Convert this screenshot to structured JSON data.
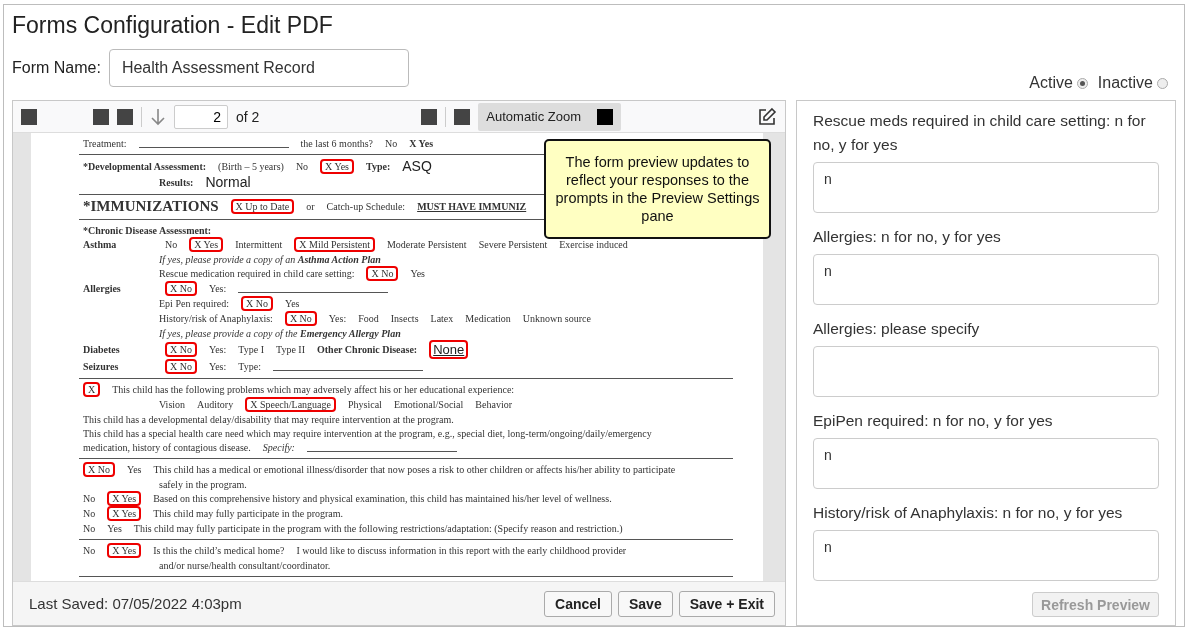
{
  "window": {
    "title": "Forms Configuration - Edit PDF"
  },
  "form_name": {
    "label": "Form Name:",
    "value": "Health Assessment Record"
  },
  "status": [
    {
      "label": "Active",
      "selected": true
    },
    {
      "label": "Inactive",
      "selected": false
    }
  ],
  "viewer_toolbar": {
    "page": "2",
    "page_count": "of 2",
    "zoom": "Automatic Zoom"
  },
  "pdf_sections": [
    [
      {
        "indent": false,
        "segments": [
          {
            "kind": "text",
            "text": "Treatment:"
          },
          {
            "kind": "blank"
          },
          {
            "kind": "text",
            "text": "the last 6 months?"
          },
          {
            "kind": "text",
            "text": "No"
          },
          {
            "kind": "bold",
            "text": "X Yes"
          }
        ]
      }
    ],
    [
      {
        "indent": false,
        "segments": [
          {
            "kind": "bold",
            "text": "*Developmental Assessment:"
          },
          {
            "kind": "text",
            "text": "(Birth – 5 years)"
          },
          {
            "kind": "text",
            "text": "No"
          },
          {
            "kind": "mark",
            "text": "X Yes"
          },
          {
            "kind": "bold",
            "text": "Type:"
          },
          {
            "kind": "value",
            "text": "ASQ"
          }
        ]
      },
      {
        "indent": true,
        "segments": [
          {
            "kind": "bold",
            "text": "Results:"
          },
          {
            "kind": "value",
            "text": "Normal"
          }
        ]
      }
    ],
    [
      {
        "indent": false,
        "segments": [
          {
            "kind": "heading",
            "text": "*IMMUNIZATIONS"
          },
          {
            "kind": "mark",
            "text": "X Up to Date"
          },
          {
            "kind": "text",
            "text": "or"
          },
          {
            "kind": "text",
            "text": "Catch-up Schedule:"
          },
          {
            "kind": "link",
            "text": "MUST HAVE IMMUNIZ"
          }
        ]
      }
    ],
    [
      {
        "indent": false,
        "segments": [
          {
            "kind": "bold",
            "text": "*Chronic Disease Assessment:"
          }
        ]
      },
      {
        "indent": false,
        "segments": [
          {
            "kind": "rowlabel",
            "text": "Asthma"
          },
          {
            "kind": "text",
            "text": "No"
          },
          {
            "kind": "mark",
            "text": "X Yes"
          },
          {
            "kind": "text",
            "text": "Intermittent"
          },
          {
            "kind": "mark",
            "text": "X Mild Persistent"
          },
          {
            "kind": "text",
            "text": "Moderate Persistent"
          },
          {
            "kind": "text",
            "text": "Severe Persistent"
          },
          {
            "kind": "text",
            "text": "Exercise induced"
          }
        ]
      },
      {
        "indent": true,
        "segments": [
          {
            "kind": "italic",
            "text": "If yes, please provide a copy of an **Asthma Action Plan**"
          }
        ]
      },
      {
        "indent": true,
        "segments": [
          {
            "kind": "text",
            "text": "Rescue medication required in child care setting:"
          },
          {
            "kind": "mark",
            "text": "X No"
          },
          {
            "kind": "text",
            "text": "Yes"
          }
        ]
      },
      {
        "indent": false,
        "segments": [
          {
            "kind": "rowlabel",
            "text": "Allergies"
          },
          {
            "kind": "mark",
            "text": "X No"
          },
          {
            "kind": "text",
            "text": "Yes:"
          },
          {
            "kind": "blank"
          }
        ]
      },
      {
        "indent": true,
        "segments": [
          {
            "kind": "text",
            "text": "Epi Pen required:"
          },
          {
            "kind": "mark",
            "text": "X No"
          },
          {
            "kind": "text",
            "text": "Yes"
          }
        ]
      },
      {
        "indent": true,
        "segments": [
          {
            "kind": "text",
            "text": "History/risk of Anaphylaxis:"
          },
          {
            "kind": "mark",
            "text": "X No"
          },
          {
            "kind": "text",
            "text": "Yes:"
          },
          {
            "kind": "text",
            "text": "Food"
          },
          {
            "kind": "text",
            "text": "Insects"
          },
          {
            "kind": "text",
            "text": "Latex"
          },
          {
            "kind": "text",
            "text": "Medication"
          },
          {
            "kind": "text",
            "text": "Unknown source"
          }
        ]
      },
      {
        "indent": true,
        "segments": [
          {
            "kind": "italic",
            "text": "If yes, please provide a copy of the **Emergency Allergy Plan**"
          }
        ]
      },
      {
        "indent": false,
        "segments": [
          {
            "kind": "rowlabel",
            "text": "Diabetes"
          },
          {
            "kind": "mark",
            "text": "X No"
          },
          {
            "kind": "text",
            "text": "Yes:"
          },
          {
            "kind": "text",
            "text": "Type I"
          },
          {
            "kind": "text",
            "text": "Type II"
          },
          {
            "kind": "bold",
            "text": "Other Chronic Disease:"
          },
          {
            "kind": "markvalue",
            "text": "None"
          }
        ]
      },
      {
        "indent": false,
        "segments": [
          {
            "kind": "rowlabel",
            "text": "Seizures"
          },
          {
            "kind": "mark",
            "text": "X No"
          },
          {
            "kind": "text",
            "text": "Yes:"
          },
          {
            "kind": "text",
            "text": "Type:"
          },
          {
            "kind": "blank"
          }
        ]
      }
    ],
    [
      {
        "indent": false,
        "segments": [
          {
            "kind": "mark",
            "text": "X"
          },
          {
            "kind": "text",
            "text": "This child has the following problems which may adversely affect his or her educational experience:"
          }
        ]
      },
      {
        "indent": true,
        "segments": [
          {
            "kind": "text",
            "text": "Vision"
          },
          {
            "kind": "text",
            "text": "Auditory"
          },
          {
            "kind": "mark",
            "text": "X Speech/Language"
          },
          {
            "kind": "text",
            "text": "Physical"
          },
          {
            "kind": "text",
            "text": "Emotional/Social"
          },
          {
            "kind": "text",
            "text": "Behavior"
          }
        ]
      },
      {
        "indent": false,
        "segments": [
          {
            "kind": "text",
            "text": "This child has a developmental delay/disability that may require intervention at the program."
          }
        ]
      },
      {
        "indent": false,
        "segments": [
          {
            "kind": "text",
            "text": "This child has a special health care need which may require intervention at the program, e.g., special diet, long-term/ongoing/daily/emergency"
          }
        ]
      },
      {
        "indent": false,
        "segments": [
          {
            "kind": "text",
            "text": "medication, history of contagious disease."
          },
          {
            "kind": "italic",
            "text": "Specify:"
          },
          {
            "kind": "blank"
          }
        ]
      }
    ],
    [
      {
        "indent": false,
        "segments": [
          {
            "kind": "mark",
            "text": "X No"
          },
          {
            "kind": "text",
            "text": "Yes"
          },
          {
            "kind": "text",
            "text": "This child has a medical or emotional illness/disorder that now poses a risk to other children or affects his/her ability to participate"
          }
        ]
      },
      {
        "indent": true,
        "segments": [
          {
            "kind": "text",
            "text": "safely in the program."
          }
        ]
      },
      {
        "indent": false,
        "segments": [
          {
            "kind": "text",
            "text": "No"
          },
          {
            "kind": "mark",
            "text": "X Yes"
          },
          {
            "kind": "text",
            "text": "Based on this comprehensive history and physical examination, this child has maintained his/her level of wellness."
          }
        ]
      },
      {
        "indent": false,
        "segments": [
          {
            "kind": "text",
            "text": "No"
          },
          {
            "kind": "mark",
            "text": "X Yes"
          },
          {
            "kind": "text",
            "text": "This child may fully participate in the program."
          }
        ]
      },
      {
        "indent": false,
        "segments": [
          {
            "kind": "text",
            "text": "No"
          },
          {
            "kind": "text",
            "text": "Yes"
          },
          {
            "kind": "text",
            "text": "This child may fully participate in the program with the following restrictions/adaptation: (Specify reason and restriction.)"
          }
        ]
      }
    ],
    [
      {
        "indent": false,
        "segments": [
          {
            "kind": "text",
            "text": "No"
          },
          {
            "kind": "mark",
            "text": "X Yes"
          },
          {
            "kind": "text",
            "text": "Is this the child’s medical home?"
          },
          {
            "kind": "text",
            "text": "I would like to discuss information in this report with the early childhood provider"
          }
        ]
      },
      {
        "indent": true,
        "segments": [
          {
            "kind": "text",
            "text": "and/or nurse/health consultant/coordinator."
          }
        ]
      }
    ]
  ],
  "tooltip": "The form preview updates to reflect your responses to the prompts in the Preview Settings pane",
  "footer": {
    "last_saved": "Last Saved: 07/05/2022 4:03pm",
    "buttons": [
      "Cancel",
      "Save",
      "Save + Exit"
    ]
  },
  "prompts": [
    {
      "label": "Rescue meds required in child care setting: n for no, y for yes",
      "value": "n"
    },
    {
      "label": "Allergies: n for no, y for yes",
      "value": "n"
    },
    {
      "label": "Allergies: please specify"
    },
    {
      "label": "EpiPen required: n for no, y for yes",
      "value": "n"
    },
    {
      "label": "History/risk of Anaphylaxis: n for no, y for yes",
      "value": "n"
    }
  ],
  "refresh_button": {
    "label": "Refresh Preview",
    "disabled": true
  }
}
